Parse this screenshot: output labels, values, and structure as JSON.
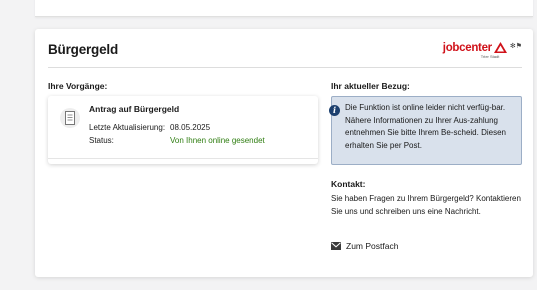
{
  "card": {
    "title": "Bürgergeld",
    "logo_text": "jobcenter",
    "logo_subtitle": "Trier Stadt"
  },
  "vorgaenge": {
    "heading": "Ihre Vorgänge:",
    "items": [
      {
        "title": "Antrag auf Bürgergeld",
        "updated_label": "Letzte Aktualisierung:",
        "updated_value": "08.05.2025",
        "status_label": "Status:",
        "status_value": "Von Ihnen online gesendet"
      }
    ]
  },
  "bezug": {
    "heading": "Ihr aktueller Bezug:",
    "info_text": "Die Funktion ist online leider nicht verfüg-bar. Nähere Informationen zu Ihrer Aus-zahlung entnehmen Sie bitte Ihrem Be-scheid. Diesen erhalten Sie per Post."
  },
  "kontakt": {
    "heading": "Kontakt:",
    "text": "Sie haben Fragen zu Ihrem Bürgergeld? Kontaktieren Sie uns und schreiben uns eine Nachricht.",
    "link_label": "Zum Postfach"
  },
  "colors": {
    "status_green": "#2e7d10",
    "info_bg": "#d9e1ec",
    "info_border": "#9caec6",
    "brand_red": "#d0121a"
  }
}
